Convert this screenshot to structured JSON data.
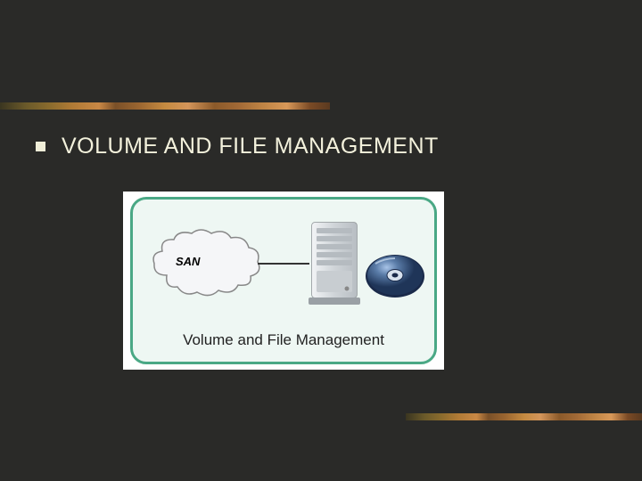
{
  "heading": "VOLUME AND FILE MANAGEMENT",
  "diagram": {
    "san_label": "SAN",
    "caption": "Volume and File Management"
  }
}
